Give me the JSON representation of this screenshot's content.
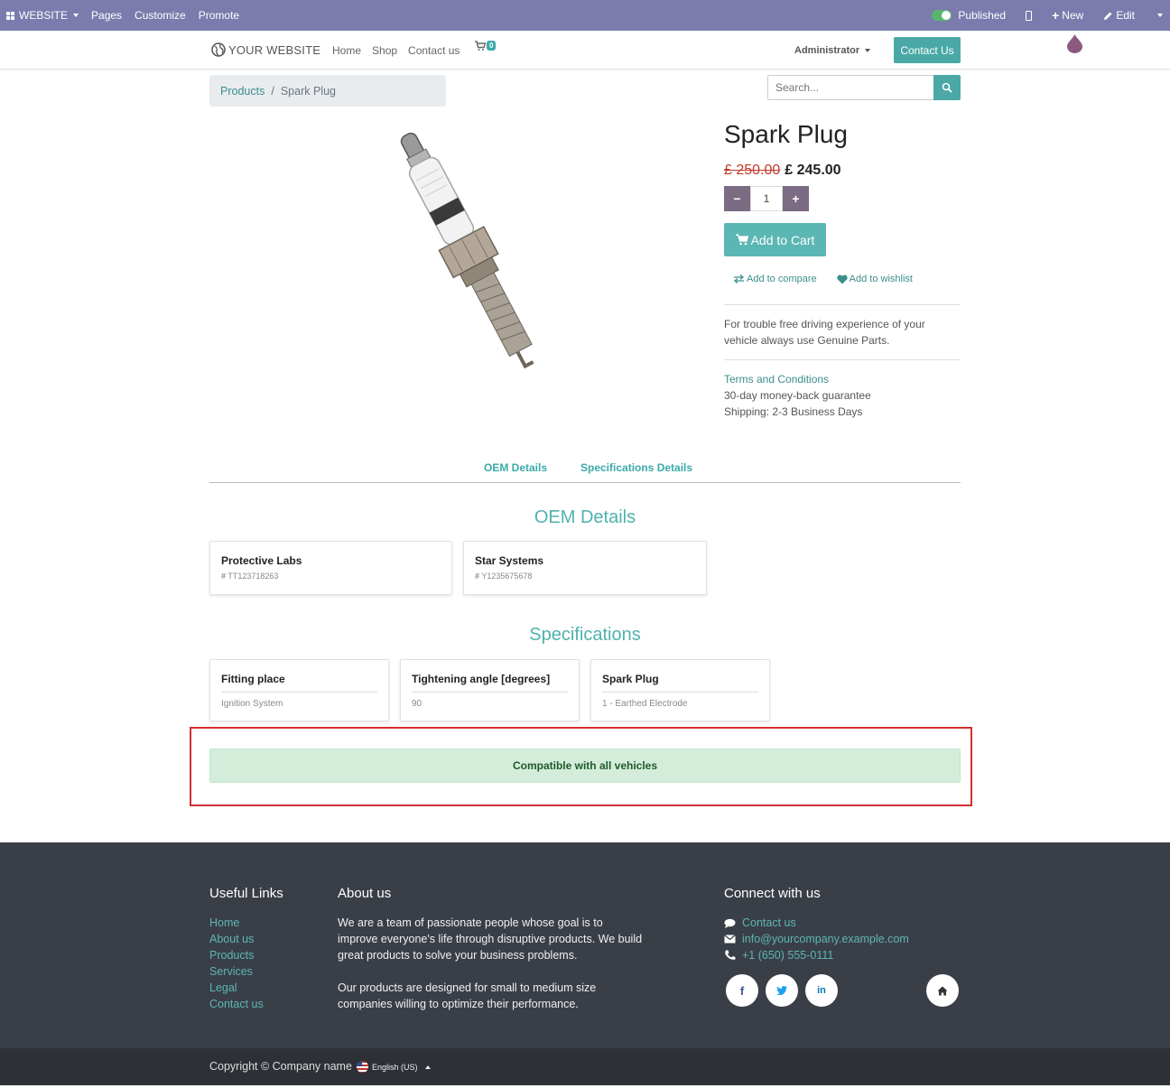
{
  "admin_bar": {
    "website": "WEBSITE",
    "pages": "Pages",
    "customize": "Customize",
    "promote": "Promote",
    "published": "Published",
    "new": "New",
    "edit": "Edit"
  },
  "header": {
    "logo": "YOUR WEBSITE",
    "nav": [
      "Home",
      "Shop",
      "Contact us"
    ],
    "cart_count": "0",
    "user": "Administrator",
    "contact_button": "Contact Us"
  },
  "breadcrumb": {
    "parent": "Products",
    "separator": "/",
    "current": "Spark Plug"
  },
  "search": {
    "placeholder": "Search..."
  },
  "product": {
    "name": "Spark Plug",
    "old_price": "£ 250.00",
    "price": "£ 245.00",
    "quantity": "1",
    "add_to_cart": "Add to Cart",
    "add_to_compare": "Add to compare",
    "add_to_wishlist": "Add to wishlist",
    "description": "For trouble free driving experience of your vehicle always use Genuine Parts.",
    "terms": "Terms and Conditions",
    "guarantee": "30-day money-back guarantee",
    "shipping": "Shipping: 2-3 Business Days"
  },
  "tabs": [
    "OEM Details",
    "Specifications Details"
  ],
  "oem": {
    "title": "OEM Details",
    "items": [
      {
        "name": "Protective Labs",
        "code": "TT123718263"
      },
      {
        "name": "Star Systems",
        "code": "Y1235675678"
      }
    ]
  },
  "specs": {
    "title": "Specifications",
    "items": [
      {
        "name": "Fitting place",
        "value": "Ignition System"
      },
      {
        "name": "Tightening angle [degrees]",
        "value": "90"
      },
      {
        "name": "Spark Plug",
        "value": "1 - Earthed Electrode"
      }
    ]
  },
  "compatibility": "Compatible with all vehicles",
  "footer": {
    "useful_links_title": "Useful Links",
    "useful_links": [
      "Home",
      "About us",
      "Products",
      "Services",
      "Legal",
      "Contact us"
    ],
    "about_title": "About us",
    "about_p1": "We are a team of passionate people whose goal is to improve everyone's life through disruptive products. We build great products to solve your business problems.",
    "about_p2": "Our products are designed for small to medium size companies willing to optimize their performance.",
    "connect_title": "Connect with us",
    "contact_link": "Contact us",
    "email": "info@yourcompany.example.com",
    "phone": "+1 (650) 555-0111",
    "copyright": "Copyright © Company name",
    "language": "English (US)"
  },
  "colors": {
    "admin_bar": "#7c7bad",
    "accent": "#4aa9a6",
    "footer": "#3a3f47",
    "compat_bg": "#d4edda",
    "highlight": "#d32f2f"
  }
}
